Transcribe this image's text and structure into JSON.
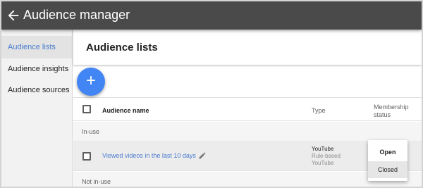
{
  "appbar": {
    "title": "Audience manager",
    "back_icon": "arrow-left-icon"
  },
  "sidebar": {
    "items": [
      {
        "label": "Audience lists",
        "active": true
      },
      {
        "label": "Audience insights",
        "active": false
      },
      {
        "label": "Audience sources",
        "active": false
      }
    ]
  },
  "main": {
    "title": "Audience lists",
    "fab": {
      "label": "+",
      "icon": "plus-icon",
      "color": "#4285f4"
    },
    "table": {
      "columns": {
        "name": "Audience name",
        "type": "Type",
        "membership": "Membership status"
      },
      "groups": [
        {
          "label": "In-use",
          "rows": [
            {
              "name": "Viewed videos in the last 10 days",
              "type": "YouTube",
              "type_detail_1": "Rule-based",
              "type_detail_2": "YouTube"
            }
          ]
        },
        {
          "label": "Not in-use",
          "rows": []
        }
      ]
    },
    "status_menu": {
      "options": [
        "Open",
        "Closed"
      ],
      "highlighted": "Closed"
    }
  },
  "colors": {
    "appbar": "#4a4a4a",
    "accent_link": "#4a7bd0",
    "fab": "#4285f4"
  }
}
